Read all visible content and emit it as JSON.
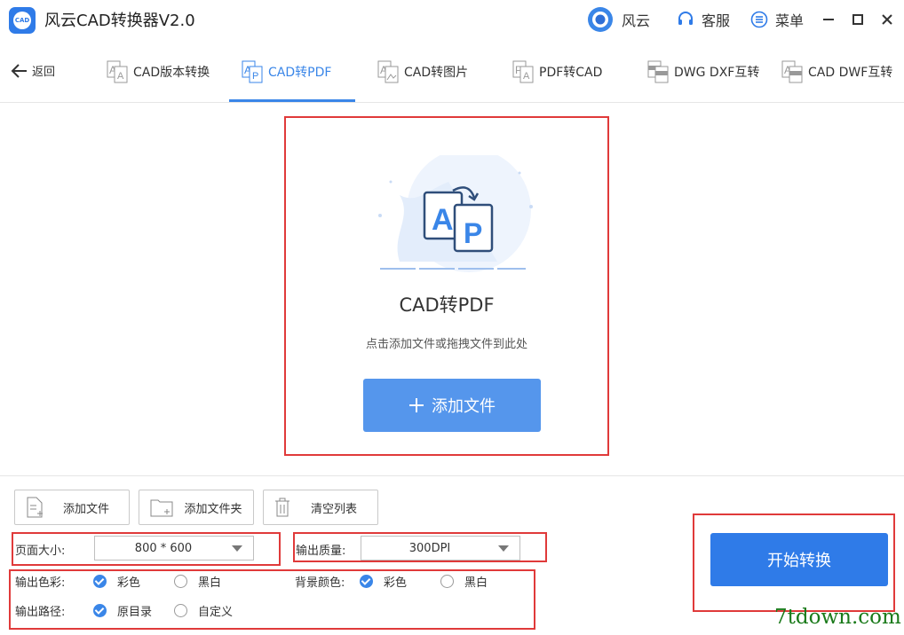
{
  "app": {
    "logo_text": "CAD",
    "title": "风云CAD转换器V2.0"
  },
  "titlebar": {
    "brand_label": "风云",
    "service_label": "客服",
    "menu_label": "菜单"
  },
  "nav": {
    "back_label": "返回",
    "tabs": [
      {
        "label": "CAD版本转换",
        "icon": "cad-version-icon"
      },
      {
        "label": "CAD转PDF",
        "icon": "cad-to-pdf-icon",
        "active": true
      },
      {
        "label": "CAD转图片",
        "icon": "cad-to-image-icon"
      },
      {
        "label": "PDF转CAD",
        "icon": "pdf-to-cad-icon"
      },
      {
        "label": "DWG DXF互转",
        "icon": "dwg-dxf-icon"
      },
      {
        "label": "CAD DWF互转",
        "icon": "cad-dwf-icon"
      }
    ]
  },
  "dropzone": {
    "title": "CAD转PDF",
    "hint": "点击添加文件或拖拽文件到此处",
    "add_button": "添加文件"
  },
  "toolbar": {
    "add_file": "添加文件",
    "add_folder": "添加文件夹",
    "clear_list": "清空列表"
  },
  "settings": {
    "page_size_label": "页面大小:",
    "page_size_value": "800 * 600",
    "quality_label": "输出质量:",
    "quality_value": "300DPI",
    "color_label": "输出色彩:",
    "color_options": [
      "彩色",
      "黑白"
    ],
    "color_selected": "彩色",
    "bg_label": "背景颜色:",
    "bg_options": [
      "彩色",
      "黑白"
    ],
    "bg_selected": "彩色",
    "path_label": "输出路径:",
    "path_options": [
      "原目录",
      "自定义"
    ],
    "path_selected": "原目录"
  },
  "start_button": "开始转换",
  "watermark": "7tdown.com",
  "colors": {
    "accent": "#3a86e8",
    "primary_button": "#2f7be8",
    "highlight_frame": "#e03a3a",
    "watermark": "#1a7a1a"
  }
}
